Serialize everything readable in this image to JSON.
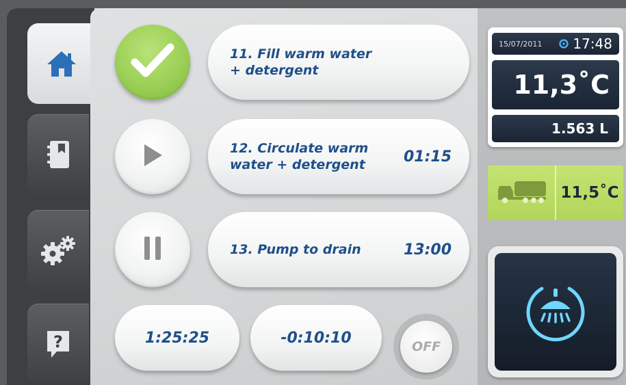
{
  "colors": {
    "accent_blue": "#1f4f8a",
    "done_green": "#9bd056",
    "status_dark": "#1a2433",
    "truck_green": "#b1d65a",
    "glow_cyan": "#6fd6ff"
  },
  "tabs": [
    {
      "icon": "home-icon",
      "active": true
    },
    {
      "icon": "logbook-icon",
      "active": false
    },
    {
      "icon": "gears-icon",
      "active": false
    },
    {
      "icon": "help-icon",
      "active": false
    }
  ],
  "steps": [
    {
      "state_icon": "checkmark-icon",
      "label": "11. Fill warm water\n+ detergent",
      "time": ""
    },
    {
      "state_icon": "play-icon",
      "label": "12. Circulate warm\nwater + detergent",
      "time": "01:15"
    },
    {
      "state_icon": "pause-icon",
      "label": "13. Pump to drain",
      "time": "13:00"
    }
  ],
  "timers": {
    "elapsed": "1:25:25",
    "remaining": "-0:10:10"
  },
  "off_label": "OFF",
  "status": {
    "date": "15/07/2011",
    "time": "17:48",
    "temperature": "11,3˚C",
    "volume": "1.563 L"
  },
  "truck": {
    "icon": "truck-icon",
    "temperature": "11,5˚C"
  },
  "wash_button": {
    "icon": "shower-power-icon"
  }
}
